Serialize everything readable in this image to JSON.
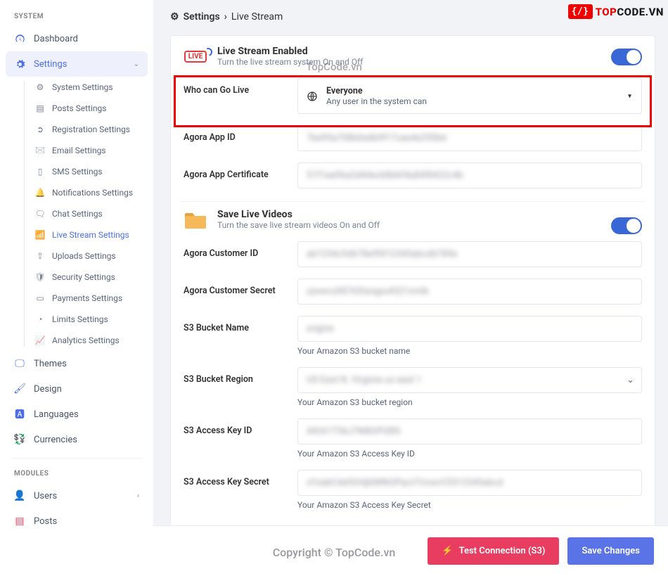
{
  "sidebar": {
    "section1": "SYSTEM",
    "section2": "MODULES",
    "items": [
      {
        "icon": "dashboard",
        "label": "Dashboard"
      },
      {
        "icon": "gear",
        "label": "Settings",
        "active": true,
        "expand": true
      },
      {
        "icon": "monitor",
        "label": "Themes"
      },
      {
        "icon": "brush",
        "label": "Design"
      },
      {
        "icon": "lang",
        "label": "Languages"
      },
      {
        "icon": "currency",
        "label": "Currencies"
      }
    ],
    "subitems": [
      {
        "icon": "gear",
        "label": "System Settings"
      },
      {
        "icon": "posts",
        "label": "Posts Settings"
      },
      {
        "icon": "login",
        "label": "Registration Settings"
      },
      {
        "icon": "mail",
        "label": "Email Settings"
      },
      {
        "icon": "sms",
        "label": "SMS Settings"
      },
      {
        "icon": "bell",
        "label": "Notifications Settings"
      },
      {
        "icon": "chat",
        "label": "Chat Settings"
      },
      {
        "icon": "signal",
        "label": "Live Stream Settings",
        "active": true
      },
      {
        "icon": "upload",
        "label": "Uploads Settings"
      },
      {
        "icon": "shield",
        "label": "Security Settings"
      },
      {
        "icon": "card",
        "label": "Payments Settings"
      },
      {
        "icon": "limits",
        "label": "Limits Settings"
      },
      {
        "icon": "analytics",
        "label": "Analytics Settings"
      }
    ],
    "modules": [
      {
        "icon": "user",
        "label": "Users",
        "chev": true
      },
      {
        "icon": "posts",
        "label": "Posts"
      }
    ]
  },
  "breadcrumb": {
    "root": "Settings",
    "sep": "›",
    "leaf": "Live Stream"
  },
  "section1": {
    "title": "Live Stream Enabled",
    "subtitle": "Turn the live stream system On and Off",
    "rows": {
      "who": {
        "label": "Who can Go Live",
        "sel_title": "Everyone",
        "sel_sub": "Any user in the system can"
      },
      "appid": {
        "label": "Agora App ID"
      },
      "appcert": {
        "label": "Agora App Certificate"
      }
    }
  },
  "section2": {
    "title": "Save Live Videos",
    "subtitle": "Turn the save live stream videos On and Off",
    "rows": {
      "custid": {
        "label": "Agora Customer ID"
      },
      "custsec": {
        "label": "Agora Customer Secret"
      },
      "bucket": {
        "label": "S3 Bucket Name",
        "help": "Your Amazon S3 bucket name"
      },
      "region": {
        "label": "S3 Bucket Region",
        "help": "Your Amazon S3 bucket region"
      },
      "akid": {
        "label": "S3 Access Key ID",
        "help": "Your Amazon S3 Access Key ID"
      },
      "aksec": {
        "label": "S3 Access Key Secret",
        "help": "Your Amazon S3 Access Key Secret"
      }
    }
  },
  "footer": {
    "test": "Test Connection (S3)",
    "save": "Save Changes"
  },
  "watermark": {
    "logo1": "{/}",
    "logo2": "TOP",
    "logo3": "CODE.VN",
    "center": "TopCode.vn",
    "copy": "Copyright © TopCode.vn"
  }
}
